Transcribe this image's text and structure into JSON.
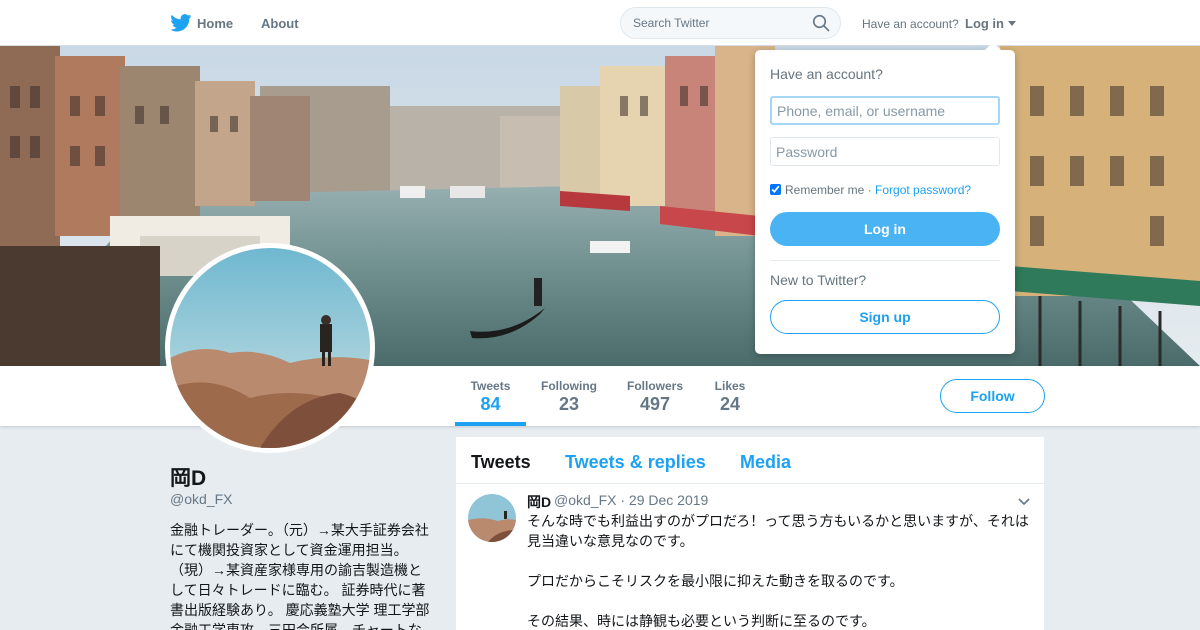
{
  "colors": {
    "brand": "#1da1f2",
    "text": "#14171a",
    "secondary": "#657786",
    "background": "#e6ecf0"
  },
  "topbar": {
    "home_label": "Home",
    "about_label": "About",
    "search_placeholder": "Search Twitter",
    "have_account": "Have an account?",
    "login_label": "Log in",
    "icons": [
      "twitter-bird-icon",
      "search-icon",
      "caret-down-icon"
    ]
  },
  "login_dropdown": {
    "title": "Have an account?",
    "username_placeholder": "Phone, email, or username",
    "password_placeholder": "Password",
    "remember_label": "Remember me",
    "separator": " · ",
    "forgot_label": "Forgot password?",
    "remember_checked": true,
    "login_button": "Log in",
    "new_to": "New to Twitter?",
    "signup_button": "Sign up"
  },
  "profile_nav": {
    "stats": [
      {
        "label": "Tweets",
        "value": "84",
        "active": true
      },
      {
        "label": "Following",
        "value": "23",
        "active": false
      },
      {
        "label": "Followers",
        "value": "497",
        "active": false
      },
      {
        "label": "Likes",
        "value": "24",
        "active": false
      }
    ],
    "follow_button": "Follow"
  },
  "profile": {
    "name": "岡D",
    "handle": "@okd_FX",
    "bio": "金融トレーダー。（元）→某大手証券会社にて機関投資家として資金運用担当。（現）→某資産家様専用の諭吉製造機として日々トレードに臨む。 証券時代に著書出版経験あり。 慶応義塾大学 理工学部 金融工学専攻。三田会所属。チャートな"
  },
  "timeline": {
    "tabs": [
      "Tweets",
      "Tweets & replies",
      "Media"
    ],
    "tweet": {
      "name": "岡D",
      "handle": "@okd_FX",
      "separator": "·",
      "date": "29 Dec 2019",
      "paragraphs": [
        "そんな時でも利益出すのがプロだろ！って思う方もいるかと思いますが、それは見当違いな意見なのです。",
        "プロだからこそリスクを最小限に抑えた動きを取るのです。",
        "その結果、時には静観も必要という判断に至るのです。"
      ]
    }
  }
}
